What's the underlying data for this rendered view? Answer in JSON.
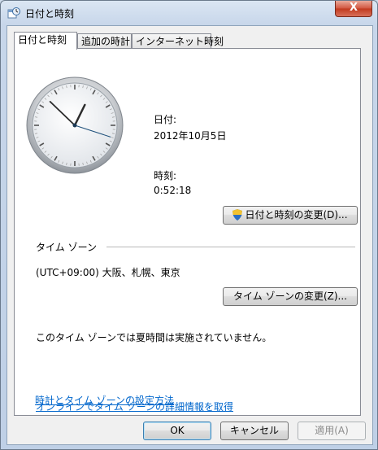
{
  "window": {
    "title": "日付と時刻",
    "close_label": "X"
  },
  "tabs": [
    {
      "label": "日付と時刻",
      "active": true
    },
    {
      "label": "追加の時計",
      "active": false
    },
    {
      "label": "インターネット時刻",
      "active": false
    }
  ],
  "date": {
    "label": "日付:",
    "value": "2012年10月5日"
  },
  "time": {
    "label": "時刻:",
    "value": "0:52:18"
  },
  "change_datetime_button": "日付と時刻の変更(D)...",
  "timezone": {
    "section_label": "タイム ゾーン",
    "value": "(UTC+09:00) 大阪、札幌、東京",
    "change_button": "タイム ゾーンの変更(Z)...",
    "dst_note": "このタイム ゾーンでは夏時間は実施されていません。"
  },
  "links": {
    "online_info": "オンラインでタイム ゾーンの詳細情報を取得",
    "how_to": "時計とタイム ゾーンの設定方法"
  },
  "footer": {
    "ok": "OK",
    "cancel": "キャンセル",
    "apply": "適用(A)"
  },
  "clock": {
    "hours": 0,
    "minutes": 52,
    "seconds": 18
  }
}
